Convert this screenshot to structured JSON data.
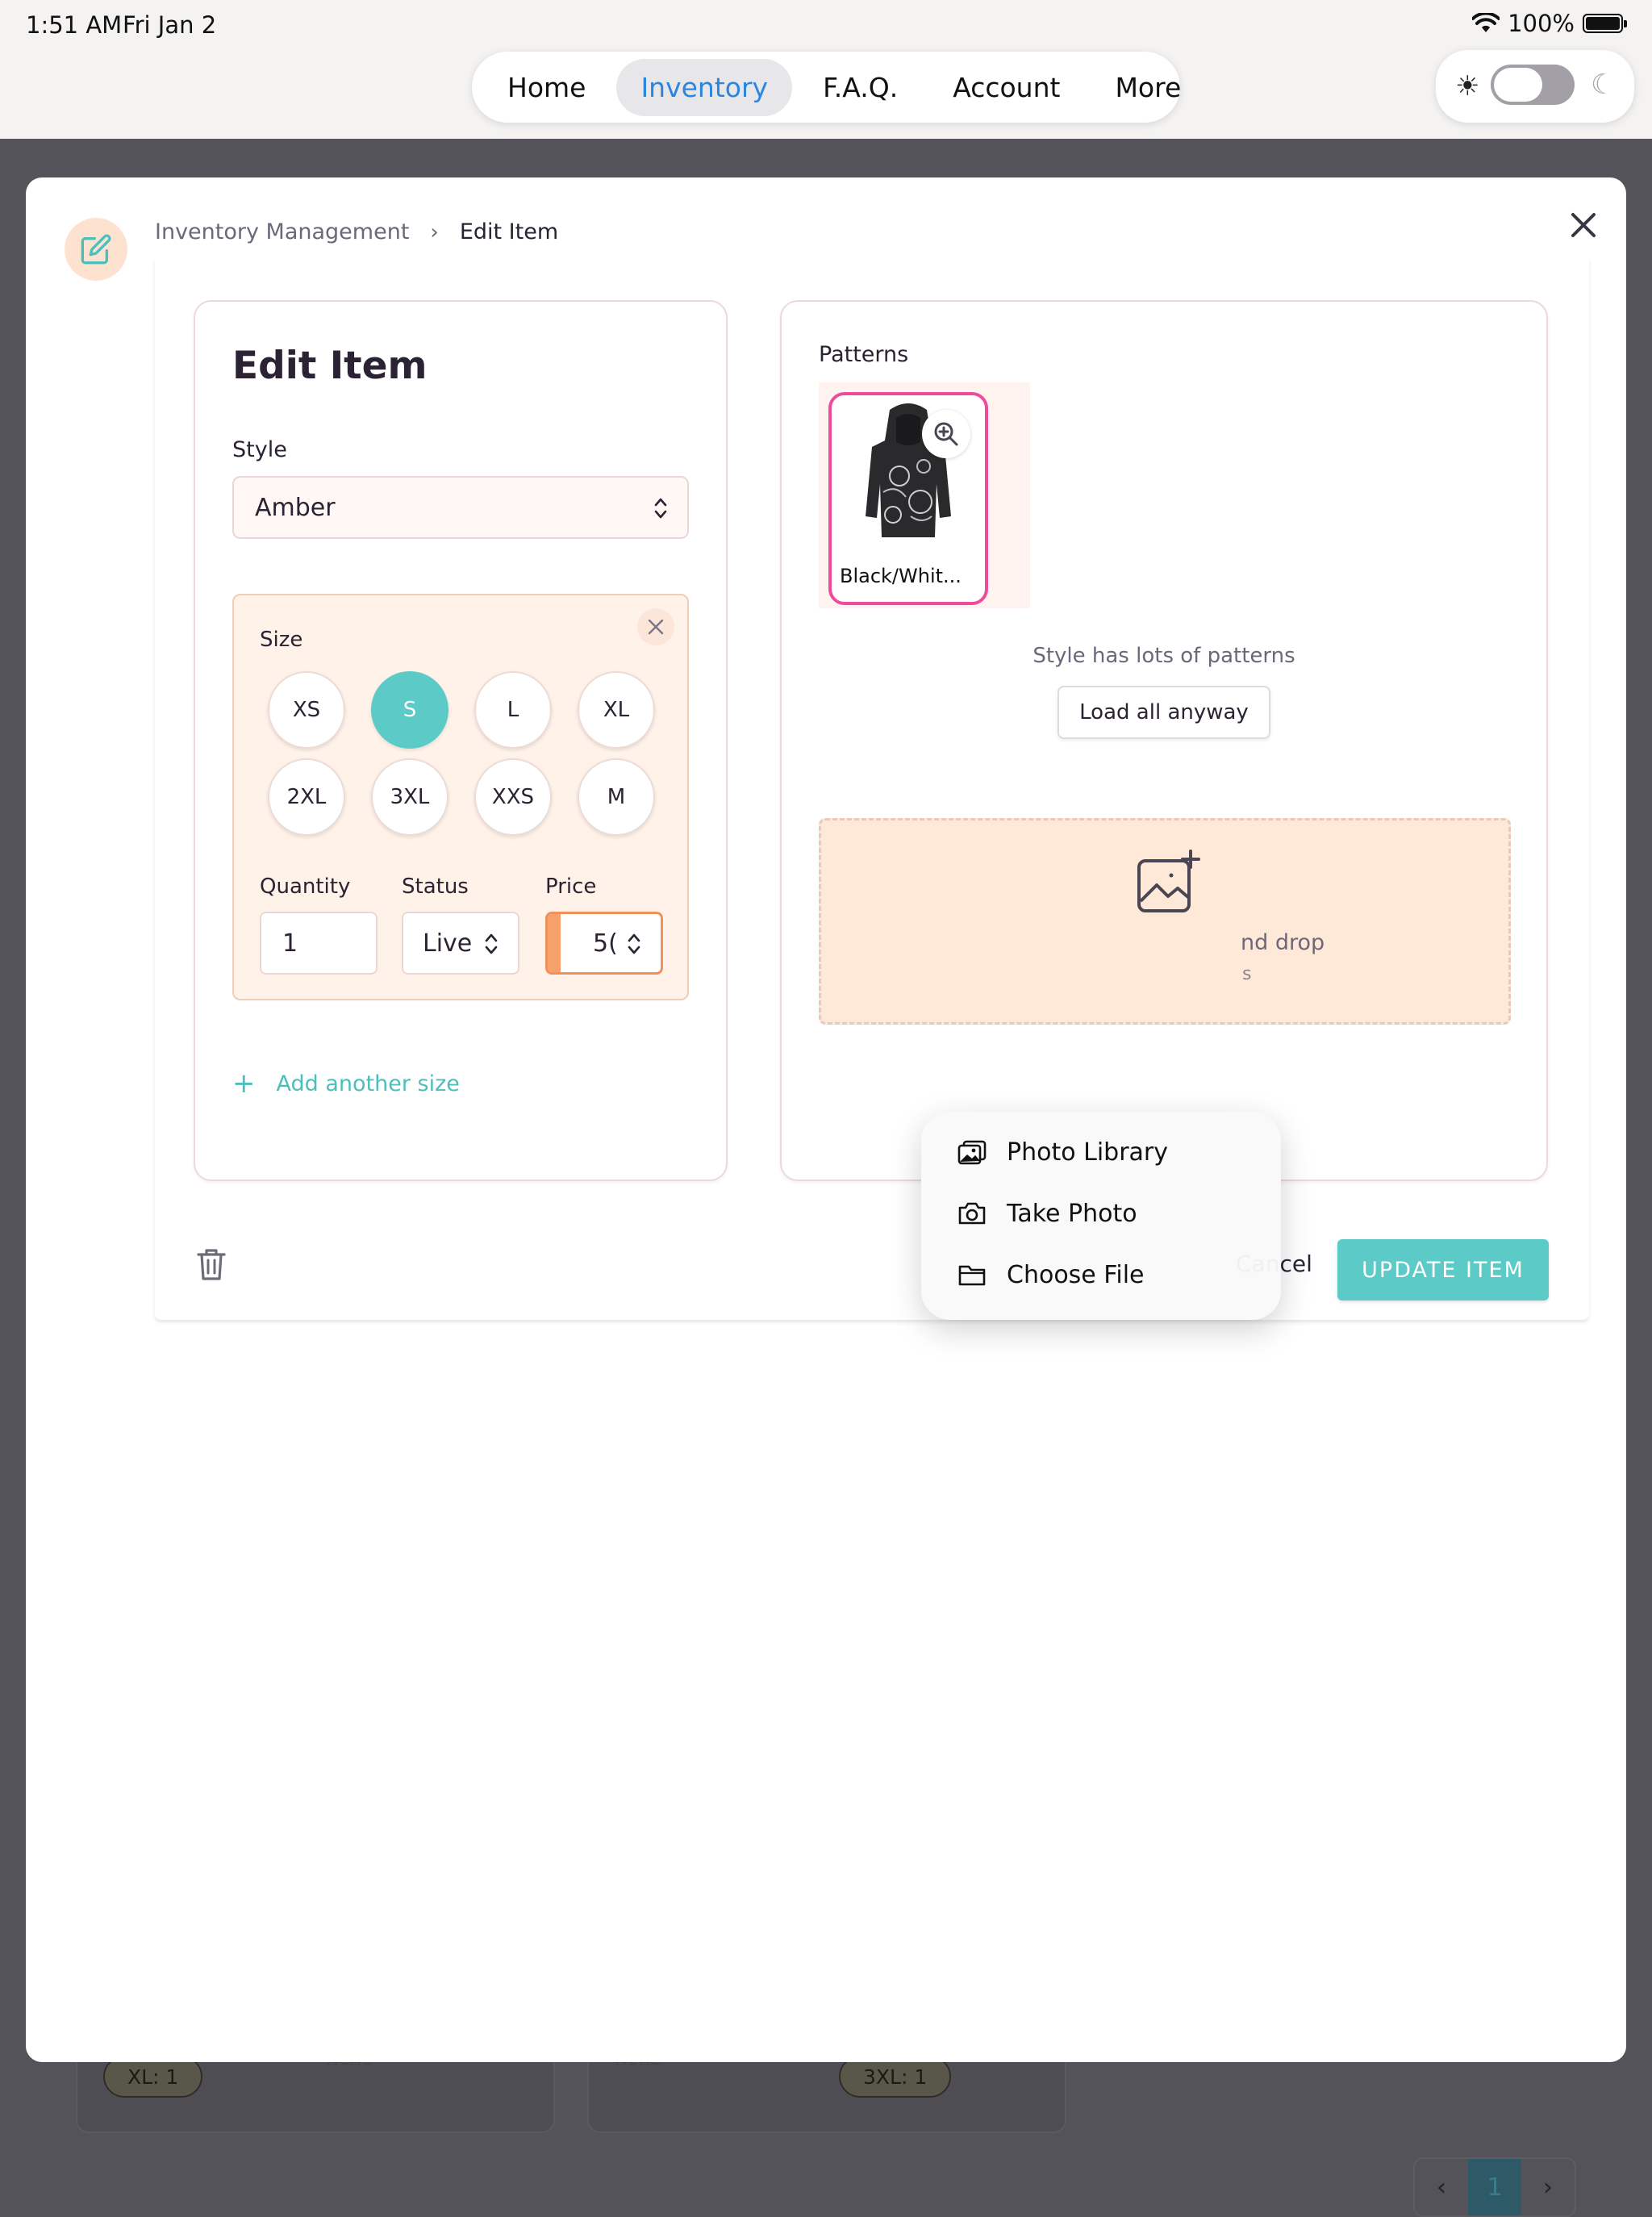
{
  "status_bar": {
    "time": "1:51 AM",
    "date": "Fri Jan 2",
    "battery": "100%",
    "battery_level": 1.0
  },
  "nav": {
    "items": [
      "Home",
      "Inventory",
      "F.A.Q.",
      "Account",
      "More"
    ],
    "active": "Inventory"
  },
  "theme_toggle": {
    "dark_mode": false
  },
  "background": {
    "chips": [
      "XL: 1",
      "3XL: 1"
    ],
    "notes": [
      "None",
      "None"
    ],
    "pager": {
      "prev": "‹",
      "current": "1",
      "next": "›"
    }
  },
  "modal": {
    "breadcrumb": {
      "parent": "Inventory Management",
      "separator": "›",
      "current": "Edit Item"
    },
    "title": "Edit Item",
    "style": {
      "label": "Style",
      "value": "Amber"
    },
    "size_section": {
      "label": "Size",
      "sizes": [
        "XS",
        "S",
        "L",
        "XL",
        "2XL",
        "3XL",
        "XXS",
        "M"
      ],
      "selected": "S",
      "quantity": {
        "label": "Quantity",
        "value": "1"
      },
      "status": {
        "label": "Status",
        "value": "Live"
      },
      "price": {
        "label": "Price",
        "value": "5("
      }
    },
    "add_size_label": "Add another size",
    "patterns": {
      "label": "Patterns",
      "items": [
        {
          "name": "Black/Whit..."
        }
      ],
      "note": "Style has lots of patterns",
      "load_all_label": "Load all anyway"
    },
    "dropzone": {
      "text": "nd drop",
      "subtext": "s"
    },
    "cancel_label": "Cancel",
    "update_label": "UPDATE ITEM"
  },
  "popup_menu": {
    "items": [
      "Photo Library",
      "Take Photo",
      "Choose File"
    ]
  },
  "colors": {
    "accent": "#5ccac6",
    "nav_active": "#2b86e0",
    "pattern_border": "#ef4b9c",
    "price_border": "#f0905c",
    "size_box_bg": "#fff2e9"
  }
}
